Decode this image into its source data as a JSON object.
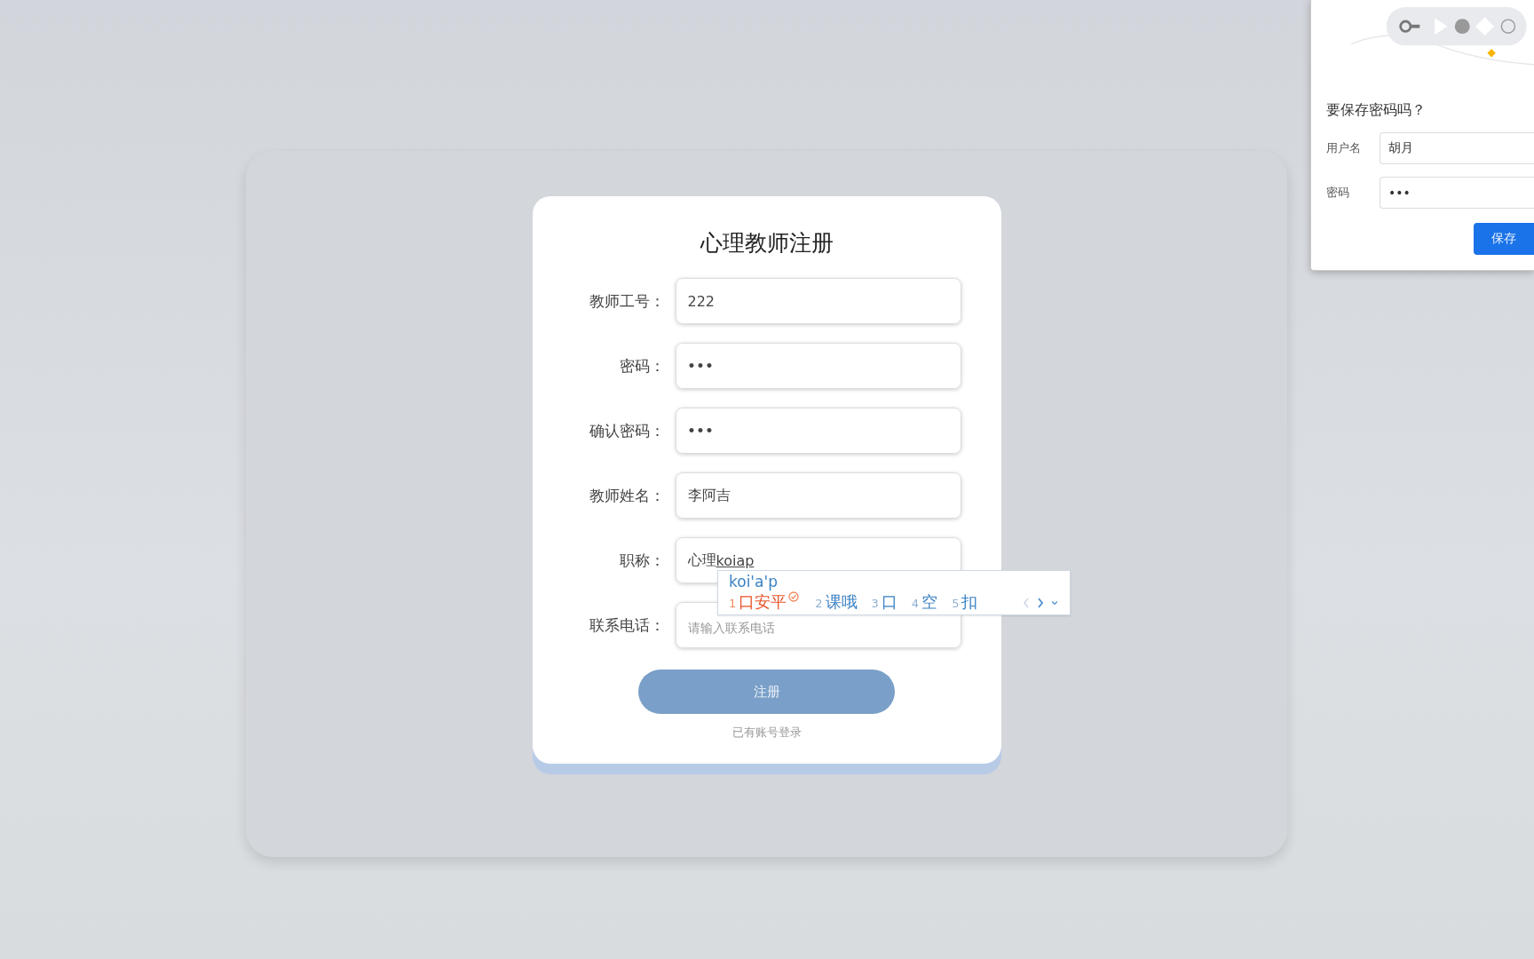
{
  "form": {
    "title": "心理教师注册",
    "fields": [
      {
        "label": "教师工号：",
        "value": "222",
        "kind": "text"
      },
      {
        "label": "密码：",
        "value": "•••",
        "kind": "password"
      },
      {
        "label": "确认密码：",
        "value": "•••",
        "kind": "password"
      },
      {
        "label": "教师姓名：",
        "value": "李阿吉",
        "kind": "text"
      },
      {
        "label": "职称：",
        "value": "心理",
        "composing": "koiap",
        "kind": "text"
      },
      {
        "label": "联系电话：",
        "placeholder": "请输入联系电话",
        "kind": "text"
      }
    ],
    "submit": "注册",
    "login_link": "已有账号登录"
  },
  "ime": {
    "composition": "koi'a'p",
    "candidates": [
      {
        "index": "1",
        "text": "口安平",
        "selected": true
      },
      {
        "index": "2",
        "text": "课哦",
        "selected": false
      },
      {
        "index": "3",
        "text": "口",
        "selected": false
      },
      {
        "index": "4",
        "text": "空",
        "selected": false
      },
      {
        "index": "5",
        "text": "扣",
        "selected": false
      }
    ]
  },
  "save_password": {
    "title": "要保存密码吗？",
    "fields": [
      {
        "label": "用户名",
        "value": "胡月"
      },
      {
        "label": "密码",
        "value": "•••"
      }
    ],
    "button": "保存"
  }
}
